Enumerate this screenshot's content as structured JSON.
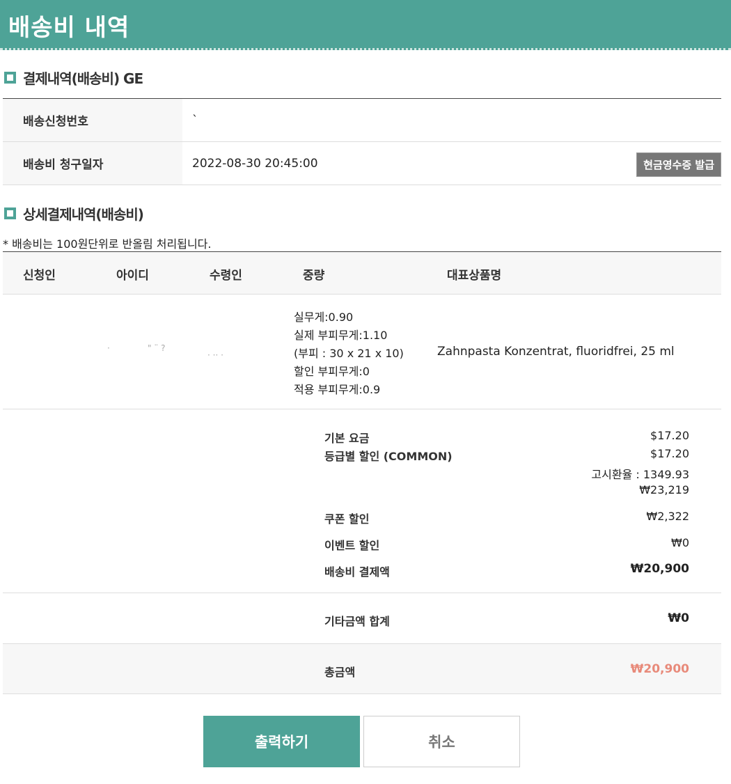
{
  "header": {
    "title": "배송비 내역"
  },
  "payment_section": {
    "title": "결제내역(배송비) GE",
    "rows": [
      {
        "label": "배송신청번호",
        "value": "`"
      },
      {
        "label": "배송비 청구일자",
        "value": "2022-08-30 20:45:00"
      }
    ],
    "receipt_button": "현금영수증 발급"
  },
  "detail_section": {
    "title": "상세결제내역(배송비)",
    "notice": "* 배송비는 100원단위로 반올림 처리됩니다.",
    "columns": [
      "신청인",
      "아이디",
      "수령인",
      "중량",
      "대표상품명"
    ],
    "row": {
      "applicant": "·",
      "user_id": "\"  ¨ ?",
      "recipient": "· ·· ·",
      "weight_lines": [
        "실무게:0.90",
        "실제 부피무게:1.10",
        "(부피 : 30 x 21 x 10)",
        "할인 부피무게:0",
        "적용 부피무게:0.9"
      ],
      "product_name": "Zahnpasta Konzentrat, fluoridfrei, 25 ml"
    }
  },
  "fees": {
    "base_label": "기본 요금",
    "base_value": "$17.20",
    "grade_label": "등급별 할인 (COMMON)",
    "grade_value": "$17.20",
    "exchange_rate": "고시환율 : 1349.93",
    "krw_value": "₩23,219",
    "coupon_label": "쿠폰 할인",
    "coupon_value": "₩2,322",
    "event_label": "이벤트 할인",
    "event_value": "₩0",
    "shipping_total_label": "배송비 결제액",
    "shipping_total_value": "₩20,900"
  },
  "etc": {
    "label": "기타금액 합계",
    "value": "₩0"
  },
  "total": {
    "label": "총금액",
    "value": "₩20,900",
    "color": "#e88a7a"
  },
  "buttons": {
    "print": "출력하기",
    "cancel": "취소"
  },
  "colors": {
    "brand": "#4ea397",
    "button_gray": "#777777"
  }
}
